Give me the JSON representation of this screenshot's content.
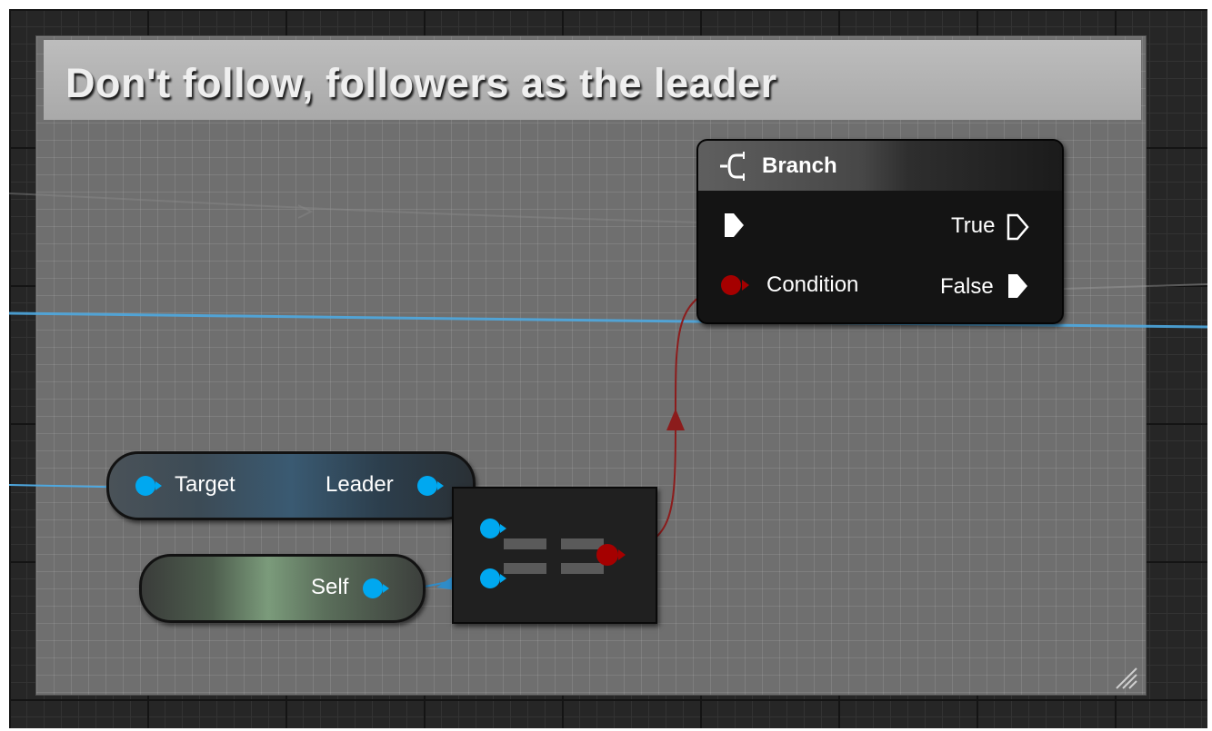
{
  "comment": {
    "title": "Don't follow, followers as the leader"
  },
  "branch_node": {
    "title": "Branch",
    "icon": "branch-icon",
    "pins": {
      "exec_in": "",
      "condition": "Condition",
      "true_out": "True",
      "false_out": "False"
    }
  },
  "get_leader_node": {
    "input_label": "Target",
    "output_label": "Leader"
  },
  "self_node": {
    "output_label": "Self"
  },
  "equal_node": {
    "icon": "equals-icon"
  },
  "colors": {
    "canvas_background": "#262626",
    "comment_background": "#6f6f6f",
    "comment_header": "#b4b4b4",
    "object_pin": "#00a8f0",
    "boolean_pin": "#a50000",
    "exec_pin": "#ffffff",
    "object_wire": "#4ea8e0",
    "boolean_wire": "#8c1c1c"
  }
}
